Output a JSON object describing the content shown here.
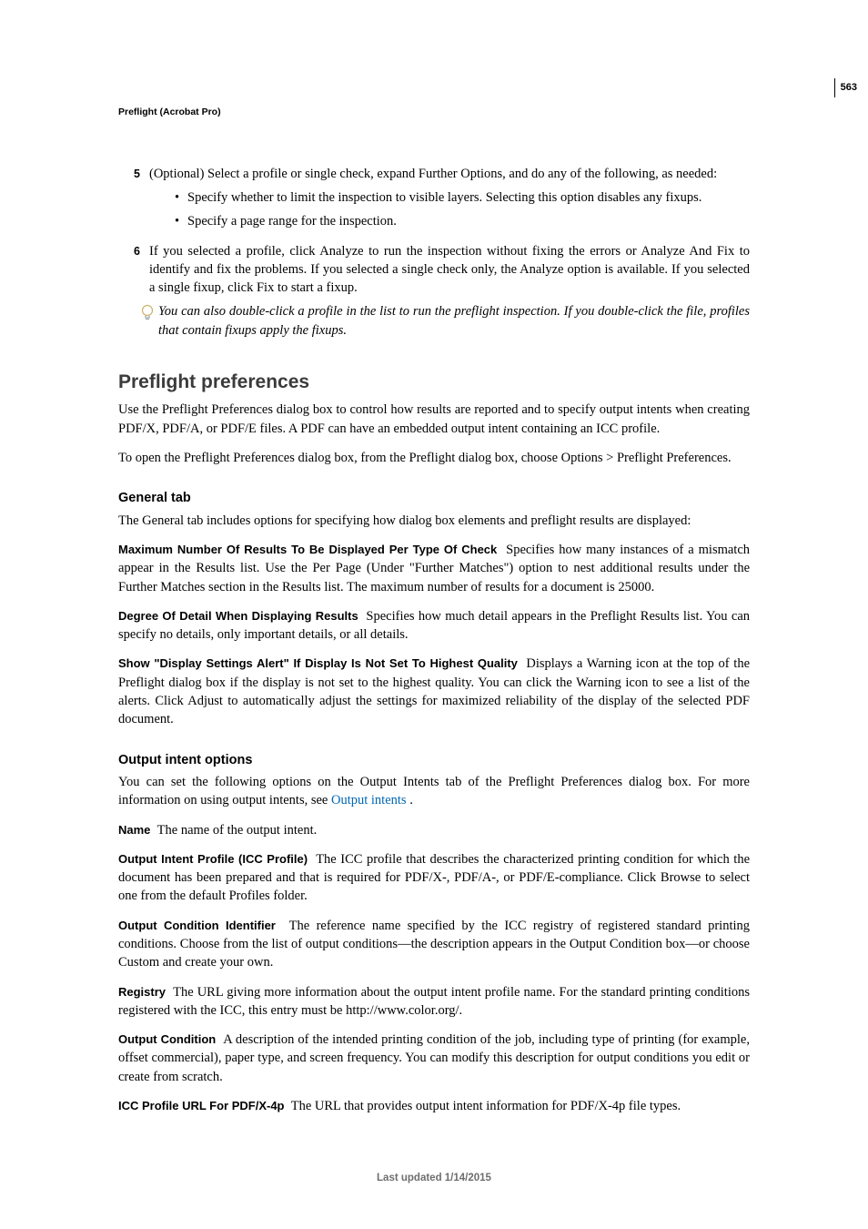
{
  "page_number": "563",
  "chapter": "Preflight (Acrobat Pro)",
  "step5": {
    "num": "5",
    "text": "(Optional) Select a profile or single check, expand Further Options, and do any of the following, as needed:",
    "bullet1": "Specify whether to limit the inspection to visible layers. Selecting this option disables any fixups.",
    "bullet2": "Specify a page range for the inspection."
  },
  "step6": {
    "num": "6",
    "text": "If you selected a profile, click Analyze to run the inspection without fixing the errors or Analyze And Fix to identify and fix the problems. If you selected a single check only, the Analyze option is available. If you selected a single fixup, click Fix to start a fixup.",
    "tip": "You can also double-click a profile in the list to run the preflight inspection. If you double-click the file, profiles that contain fixups apply the fixups."
  },
  "h2_prefs": "Preflight preferences",
  "prefs_p1": "Use the Preflight Preferences dialog box to control how results are reported and to specify output intents when creating PDF/X, PDF/A, or PDF/E files. A PDF can have an embedded output intent containing an ICC profile.",
  "prefs_p2": "To open the Preflight Preferences dialog box, from the Preflight dialog box, choose Options > Preflight Preferences.",
  "h3_general": "General tab",
  "general_intro": "The General tab includes options for specifying how dialog box elements and preflight results are displayed:",
  "max_results": {
    "term": "Maximum Number Of Results To Be Displayed Per Type Of Check",
    "desc": "Specifies how many instances of a mismatch appear in the Results list. Use the Per Page (Under \"Further Matches\") option to nest additional results under the Further Matches section in the Results list. The maximum number of results for a document is 25000."
  },
  "degree_detail": {
    "term": "Degree Of Detail When Displaying Results",
    "desc": "Specifies how much detail appears in the Preflight Results list. You can specify no details, only important details, or all details."
  },
  "display_alert": {
    "term": "Show \"Display Settings Alert\" If Display Is Not Set To Highest Quality",
    "desc": "Displays a Warning icon at the top of the Preflight dialog box if the display is not set to the highest quality. You can click the Warning icon to see a list of the alerts. Click Adjust to automatically adjust the settings for maximized reliability of the display of the selected PDF document."
  },
  "h3_output": "Output intent options",
  "output_intro_pre": "You can set the following options on the Output Intents tab of the Preflight Preferences dialog box. For more information on using output intents, see ",
  "output_intro_link": "Output intents",
  "output_intro_post": " .",
  "name_opt": {
    "term": "Name",
    "desc": "The name of the output intent."
  },
  "icc_profile": {
    "term": "Output Intent Profile (ICC Profile)",
    "desc": "The ICC profile that describes the characterized printing condition for which the document has been prepared and that is required for PDF/X-, PDF/A-, or PDF/E-compliance. Click Browse to select one from the default Profiles folder."
  },
  "cond_id": {
    "term": "Output Condition Identifier",
    "desc": "The reference name specified by the ICC registry of registered standard printing conditions. Choose from the list of output conditions—the description appears in the Output Condition box—or choose Custom and create your own."
  },
  "registry": {
    "term": "Registry",
    "desc": "The URL giving more information about the output intent profile name. For the standard printing conditions registered with the ICC, this entry must be http://www.color.org/."
  },
  "out_cond": {
    "term": "Output Condition",
    "desc": "A description of the intended printing condition of the job, including type of printing (for example, offset commercial), paper type, and screen frequency. You can modify this description for output conditions you edit or create from scratch."
  },
  "icc_url": {
    "term": "ICC Profile URL For PDF/X-4p",
    "desc": "The URL that provides output intent information for PDF/X-4p file types."
  },
  "footer": "Last updated 1/14/2015"
}
